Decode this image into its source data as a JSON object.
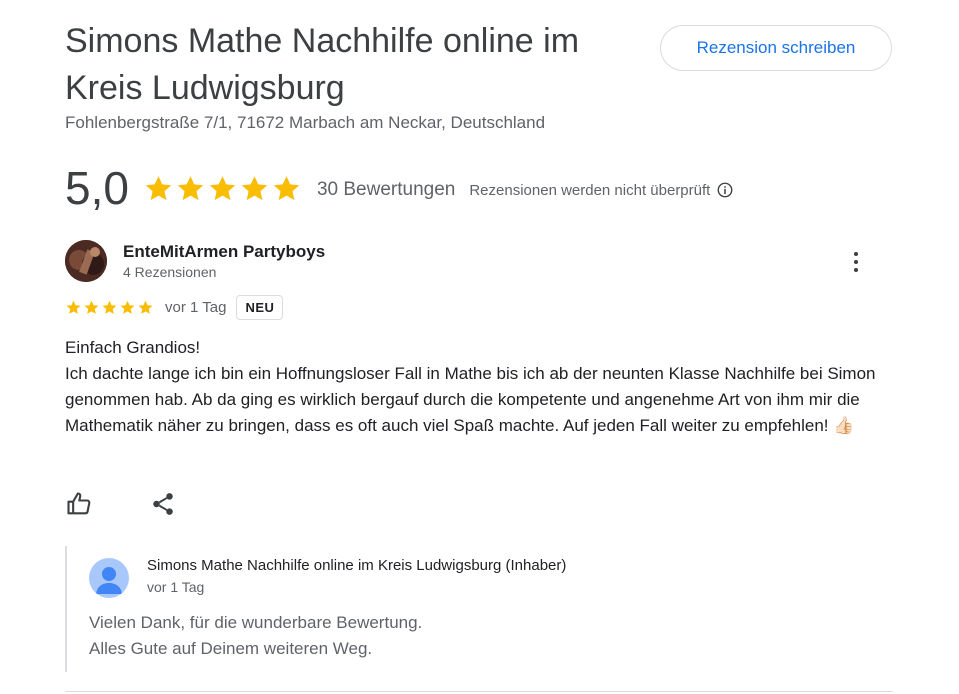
{
  "business": {
    "name": "Simons Mathe Nachhilfe online im Kreis Ludwigsburg",
    "address": "Fohlenbergstraße 7/1, 71672 Marbach am Neckar, Deutschland",
    "write_review_label": "Rezension schreiben"
  },
  "rating": {
    "value": "5,0",
    "stars": 5,
    "count_label": "30 Bewertungen",
    "unverified_label": "Rezensionen werden nicht überprüft"
  },
  "review": {
    "author": "EnteMitArmen Partyboys",
    "author_reviews": "4 Rezensionen",
    "stars": 5,
    "time": "vor 1 Tag",
    "badge": "NEU",
    "lines": [
      "Einfach Grandios!",
      "Ich dachte lange ich bin ein Hoffnungsloser Fall in Mathe bis ich ab der neunten Klasse Nachhilfe bei Simon genommen hab. Ab da ging es wirklich bergauf durch die kompetente und angenehme Art von ihm mir die Mathematik näher zu bringen, dass es oft auch viel Spaß machte. Auf jeden Fall weiter zu empfehlen! 👍🏻"
    ]
  },
  "owner_reply": {
    "name": "Simons Mathe Nachhilfe online im Kreis Ludwigsburg (Inhaber)",
    "time": "vor 1 Tag",
    "lines": [
      "Vielen Dank, für die wunderbare Bewertung.",
      "Alles Gute auf Deinem weiteren Weg."
    ]
  },
  "icons": {
    "star": "star-icon",
    "info": "info-icon",
    "more": "more-vert-icon",
    "like": "thumb-up-icon",
    "share": "share-icon",
    "owner_avatar": "person-avatar-icon"
  },
  "colors": {
    "star": "#fbbc04",
    "link": "#1a73e8",
    "text_secondary": "#5f6368",
    "border": "#dadce0"
  }
}
